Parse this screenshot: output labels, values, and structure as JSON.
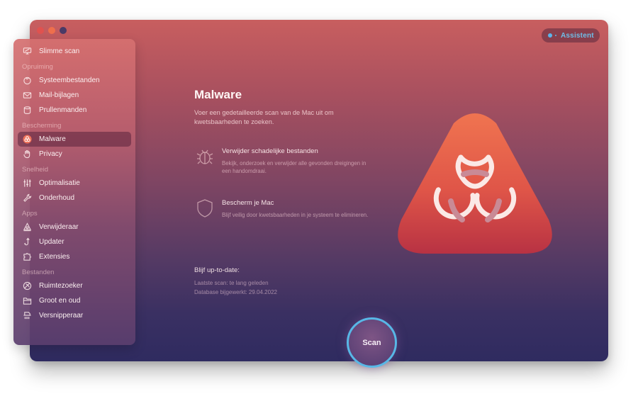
{
  "window": {
    "traffic_lights": [
      "close",
      "minimize",
      "maximize"
    ],
    "assistant_label": "Assistent"
  },
  "sidebar": {
    "top_item": {
      "label": "Slimme scan",
      "icon": "monitor-scan-icon"
    },
    "sections": [
      {
        "heading": "Opruiming",
        "items": [
          {
            "label": "Systeembestanden",
            "icon": "system-junk-icon"
          },
          {
            "label": "Mail-bijlagen",
            "icon": "envelope-icon"
          },
          {
            "label": "Prullenmanden",
            "icon": "trash-bin-icon"
          }
        ]
      },
      {
        "heading": "Bescherming",
        "items": [
          {
            "label": "Malware",
            "icon": "biohazard-icon",
            "selected": true
          },
          {
            "label": "Privacy",
            "icon": "hand-icon"
          }
        ]
      },
      {
        "heading": "Snelheid",
        "items": [
          {
            "label": "Optimalisatie",
            "icon": "sliders-icon"
          },
          {
            "label": "Onderhoud",
            "icon": "wrench-icon"
          }
        ]
      },
      {
        "heading": "Apps",
        "items": [
          {
            "label": "Verwijderaar",
            "icon": "uninstaller-icon"
          },
          {
            "label": "Updater",
            "icon": "updater-icon"
          },
          {
            "label": "Extensies",
            "icon": "puzzle-icon"
          }
        ]
      },
      {
        "heading": "Bestanden",
        "items": [
          {
            "label": "Ruimtezoeker",
            "icon": "space-lens-icon"
          },
          {
            "label": "Groot en oud",
            "icon": "folder-icon"
          },
          {
            "label": "Versnipperaar",
            "icon": "shredder-icon"
          }
        ]
      }
    ]
  },
  "main": {
    "title": "Malware",
    "description": "Voer een gedetailleerde scan van de Mac uit om kwetsbaarheden te zoeken.",
    "features": [
      {
        "icon": "bug-icon",
        "title": "Verwijder schadelijke bestanden",
        "description": "Bekijk, onderzoek en verwijder alle gevonden dreigingen in een handomdraai."
      },
      {
        "icon": "shield-icon",
        "title": "Bescherm je Mac",
        "description": "Blijf veilig door kwetsbaarheden in je systeem te elimineren."
      }
    ],
    "status": {
      "heading": "Blijf up-to-date:",
      "last_scan": "Laatste scan: te lang geleden",
      "database": "Database bijgewerkt: 29.04.2022"
    },
    "scan_button": "Scan"
  },
  "colors": {
    "accent_blue": "#58b7e6",
    "hero_top": "#ee6c4f",
    "hero_bottom": "#bb3444"
  }
}
